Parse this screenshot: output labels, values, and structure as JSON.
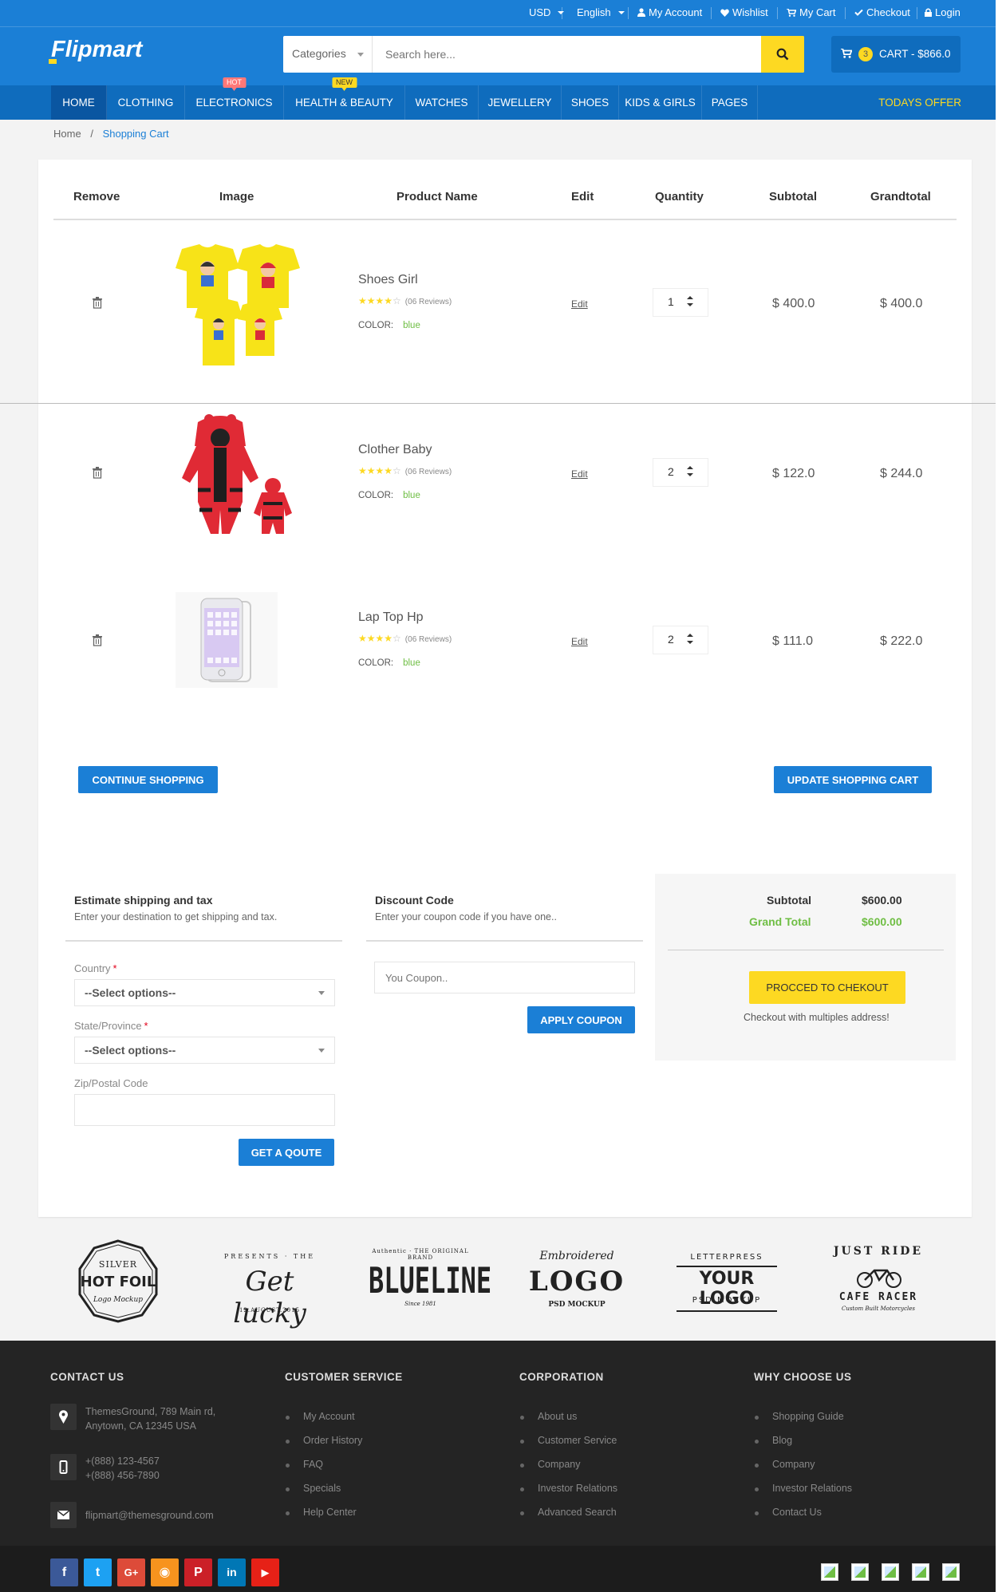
{
  "topbar": {
    "currency": "USD",
    "language": "English",
    "my_account": "My Account",
    "wishlist": "Wishlist",
    "my_cart": "My Cart",
    "checkout": "Checkout",
    "login": "Login"
  },
  "header": {
    "logo": "Flipmart",
    "search_category": "Categories",
    "search_placeholder": "Search here...",
    "cart_count": "3",
    "cart_label": "CART - $866.0"
  },
  "nav": {
    "items": [
      {
        "label": "HOME",
        "badge": ""
      },
      {
        "label": "CLOTHING",
        "badge": ""
      },
      {
        "label": "ELECTRONICS",
        "badge": "HOT"
      },
      {
        "label": "HEALTH & BEAUTY",
        "badge": "NEW"
      },
      {
        "label": "WATCHES",
        "badge": ""
      },
      {
        "label": "JEWELLERY",
        "badge": ""
      },
      {
        "label": "SHOES",
        "badge": ""
      },
      {
        "label": "KIDS & GIRLS",
        "badge": ""
      },
      {
        "label": "PAGES",
        "badge": ""
      }
    ],
    "todays_offer": "TODAYS OFFER"
  },
  "breadcrumb": {
    "home": "Home",
    "separator": "/",
    "current": "Shopping Cart"
  },
  "cart": {
    "headers": [
      "Remove",
      "Image",
      "Product Name",
      "Edit",
      "Quantity",
      "Subtotal",
      "Grandtotal"
    ],
    "items": [
      {
        "name": "Shoes Girl",
        "rating": 4,
        "reviews": "(06 Reviews)",
        "color_label": "COLOR:",
        "color": "blue",
        "edit": "Edit",
        "qty": "1",
        "subtotal": "$ 400.0",
        "grandtotal": "$ 400.0"
      },
      {
        "name": "Clother Baby",
        "rating": 4,
        "reviews": "(06 Reviews)",
        "color_label": "COLOR:",
        "color": "blue",
        "edit": "Edit",
        "qty": "2",
        "subtotal": "$ 122.0",
        "grandtotal": "$ 244.0"
      },
      {
        "name": "Lap Top Hp",
        "rating": 4,
        "reviews": "(06 Reviews)",
        "color_label": "COLOR:",
        "color": "blue",
        "edit": "Edit",
        "qty": "2",
        "subtotal": "$ 111.0",
        "grandtotal": "$ 222.0"
      }
    ],
    "continue_btn": "CONTINUE SHOPPING",
    "update_btn": "UPDATE SHOPPING CART"
  },
  "shipping": {
    "title": "Estimate shipping and tax",
    "subtitle": "Enter your destination to get shipping and tax.",
    "country_label": "Country",
    "country_value": "--Select options--",
    "state_label": "State/Province",
    "state_value": "--Select options--",
    "zip_label": "Zip/Postal Code",
    "zip_value": "",
    "required_mark": "*",
    "quote_btn": "GET A QOUTE"
  },
  "discount": {
    "title": "Discount Code",
    "subtitle": "Enter your coupon code if you have one..",
    "placeholder": "You Coupon..",
    "apply_btn": "APPLY COUPON"
  },
  "totals": {
    "subtotal_label": "Subtotal",
    "subtotal_value": "$600.00",
    "grand_label": "Grand Total",
    "grand_value": "$600.00",
    "checkout_btn": "PROCCED TO CHEKOUT",
    "multi_text": "Checkout with multiples address!"
  },
  "brands": [
    {
      "top": "SILVER",
      "main": "HOT FOIL",
      "sub": "Logo Mockup"
    },
    {
      "top": "PRESENTS · THE",
      "main": "Get lucky",
      "sub": "12.AUGUST.2015"
    },
    {
      "top": "Authentic · THE ORIGINAL BRAND",
      "main": "BLUELINE",
      "sub": "Since 1981"
    },
    {
      "top": "Embroidered",
      "main": "LOGO",
      "sub": "PSD MOCKUP"
    },
    {
      "top": "LETTERPRESS",
      "main": "YOUR LOGO",
      "sub": "PSD MOCKUP"
    },
    {
      "top": "JUST RIDE",
      "main": "CAFE RACER",
      "sub": "Custom Built Motorcycles"
    }
  ],
  "footer": {
    "contact": {
      "title": "CONTACT US",
      "address1": "ThemesGround, 789 Main rd,",
      "address2": "Anytown, CA 12345 USA",
      "phone1": "+(888) 123-4567",
      "phone2": "+(888) 456-7890",
      "email": "flipmart@themesground.com"
    },
    "customer_service": {
      "title": "CUSTOMER SERVICE",
      "items": [
        "My Account",
        "Order History",
        "FAQ",
        "Specials",
        "Help Center"
      ]
    },
    "corporation": {
      "title": "CORPORATION",
      "items": [
        "About us",
        "Customer Service",
        "Company",
        "Investor Relations",
        "Advanced Search"
      ]
    },
    "why": {
      "title": "WHY CHOOSE US",
      "items": [
        "Shopping Guide",
        "Blog",
        "Company",
        "Investor Relations",
        "Contact Us"
      ]
    }
  },
  "social": [
    {
      "name": "facebook",
      "glyph": "f",
      "color": "#3b5998"
    },
    {
      "name": "twitter",
      "glyph": "t",
      "color": "#1da1f2"
    },
    {
      "name": "google-plus",
      "glyph": "G+",
      "color": "#dd4b39"
    },
    {
      "name": "rss",
      "glyph": "◉",
      "color": "#f7931e"
    },
    {
      "name": "pinterest",
      "glyph": "P",
      "color": "#cb2027"
    },
    {
      "name": "linkedin",
      "glyph": "in",
      "color": "#0077b5"
    },
    {
      "name": "youtube",
      "glyph": "▶",
      "color": "#e62117"
    }
  ],
  "colors": {
    "primary": "#1b7fd6",
    "nav": "#0f6cbd",
    "accent_yellow": "#fdd922",
    "green": "#6fbe44",
    "footer": "#242424"
  }
}
